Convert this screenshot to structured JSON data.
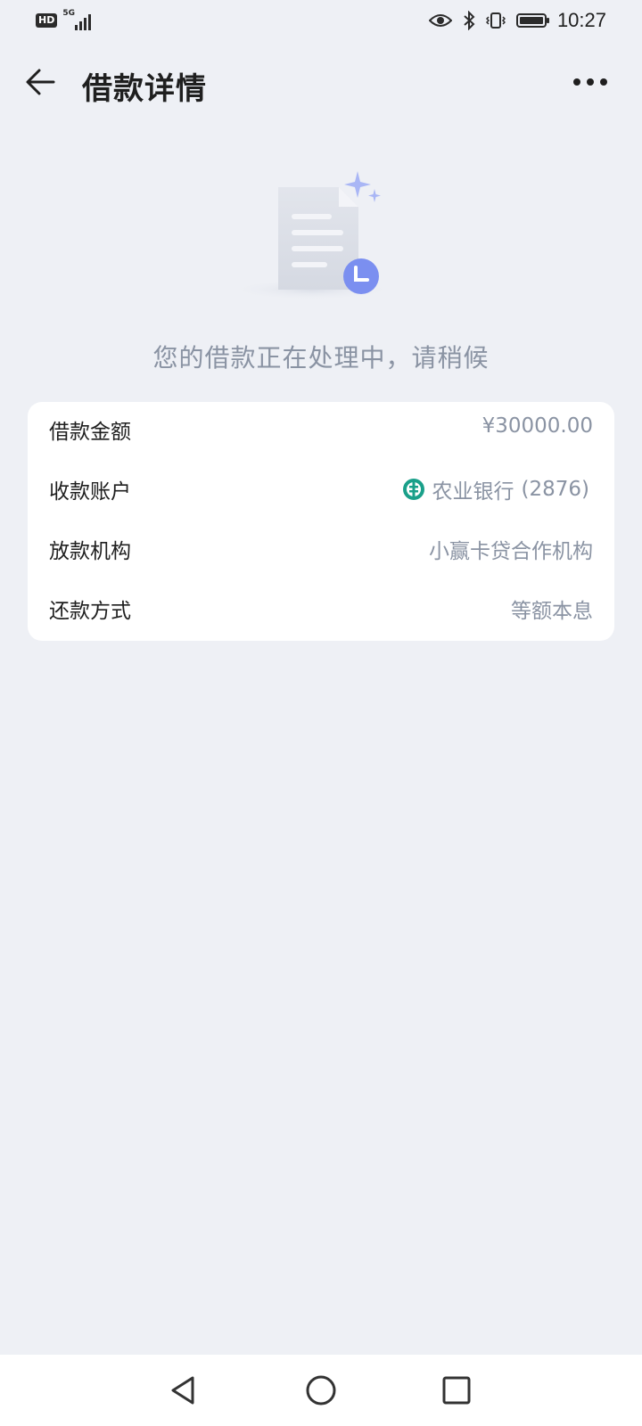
{
  "status_bar": {
    "hd_badge": "HD",
    "network": "5G",
    "time": "10:27",
    "battery_percent": 100,
    "icons": [
      "eye-icon",
      "bluetooth-icon",
      "vibrate-icon",
      "battery-icon"
    ]
  },
  "header": {
    "title": "借款详情",
    "back_icon": "arrow-left-icon",
    "more_icon": "more-dots-icon"
  },
  "illustration": {
    "icon": "document-clock-icon"
  },
  "status_message": "您的借款正在处理中，请稍候",
  "details": {
    "rows": [
      {
        "label": "借款金额",
        "value": "¥30000.00"
      },
      {
        "label": "收款账户",
        "bank_name": "农业银行",
        "account_suffix": "(2876)",
        "bank_icon": "abc-bank-logo-icon"
      },
      {
        "label": "放款机构",
        "value": "小赢卡贷合作机构"
      },
      {
        "label": "还款方式",
        "value": "等额本息"
      }
    ]
  },
  "navigation": {
    "icons": [
      "nav-back-triangle-icon",
      "nav-home-circle-icon",
      "nav-recents-square-icon"
    ]
  },
  "colors": {
    "background": "#eef0f5",
    "card": "#ffffff",
    "secondary_text": "#8a93a3",
    "accent_blue": "#7b8ff0",
    "bank_green": "#1aa08a"
  }
}
